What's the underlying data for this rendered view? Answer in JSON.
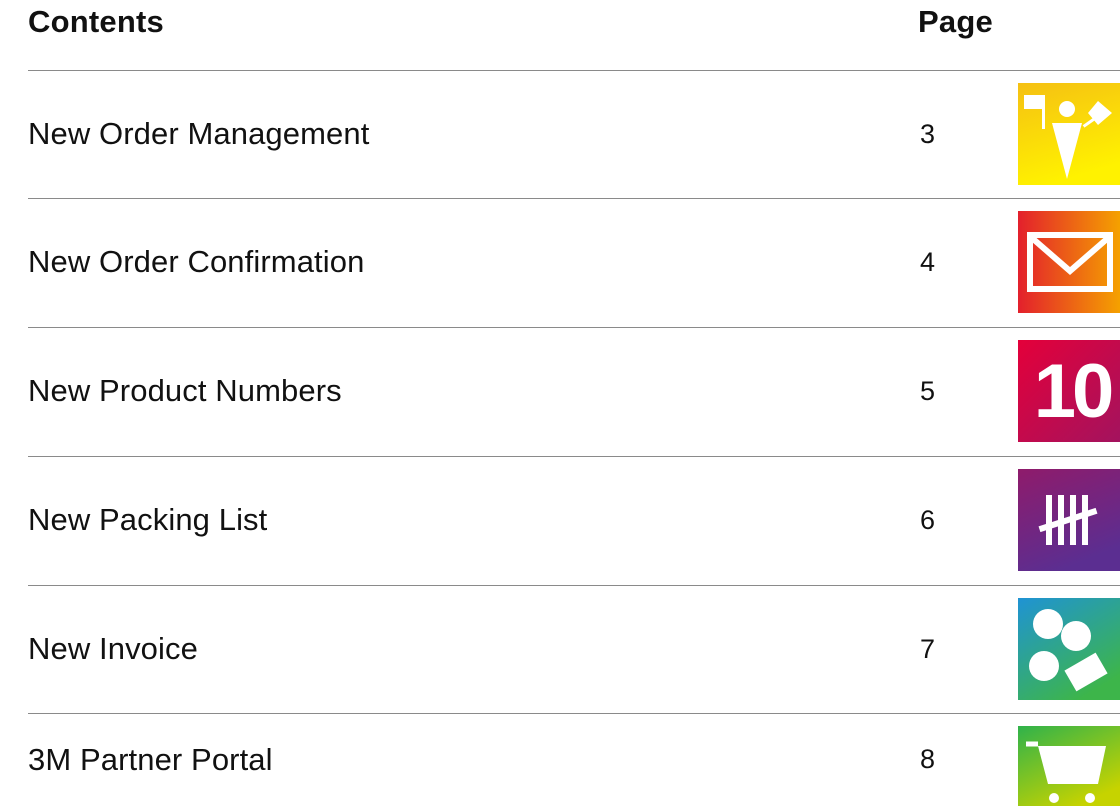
{
  "header": {
    "contents_label": "Contents",
    "page_label": "Page"
  },
  "rows": [
    {
      "title": "New Order Management",
      "page": "3",
      "icon": "order-management-icon",
      "colors": [
        "#f7c613",
        "#fff200"
      ]
    },
    {
      "title": "New Order Confirmation",
      "page": "4",
      "icon": "envelope-icon",
      "colors": [
        "#e6202e",
        "#f5a100"
      ]
    },
    {
      "title": "New Product Numbers",
      "page": "5",
      "icon": "number-ten-icon",
      "number_text": "10",
      "colors": [
        "#e4003a",
        "#8a1a6a"
      ]
    },
    {
      "title": "New Packing List",
      "page": "6",
      "icon": "tally-marks-icon",
      "colors": [
        "#8a1a6a",
        "#5a2d91"
      ]
    },
    {
      "title": "New Invoice",
      "page": "7",
      "icon": "coins-icon",
      "colors": [
        "#1a9ad6",
        "#3cb44a"
      ]
    },
    {
      "title": "3M Partner Portal",
      "page": "8",
      "icon": "shopping-cart-icon",
      "colors": [
        "#34b34a",
        "#c8d400"
      ]
    }
  ]
}
